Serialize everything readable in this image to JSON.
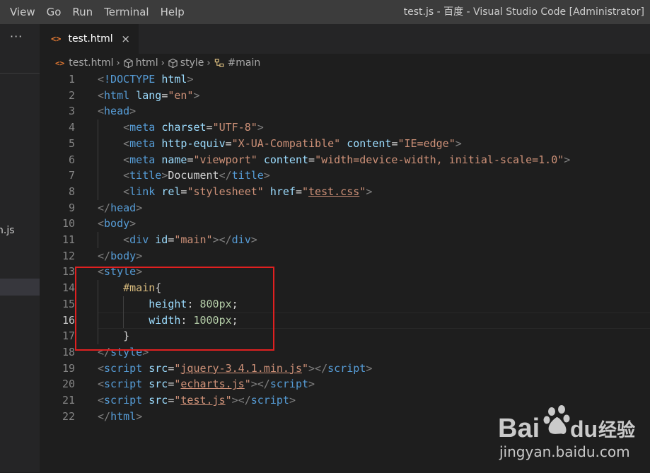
{
  "menu": [
    "View",
    "Go",
    "Run",
    "Terminal",
    "Help"
  ],
  "window_title": "test.js - 百度 - Visual Studio Code [Administrator]",
  "sidebar": {
    "more": "···",
    "file_fragment": "n.js"
  },
  "tab": {
    "icon": "<>",
    "label": "test.html",
    "close": "×"
  },
  "breadcrumb": {
    "file": "test.html",
    "html": "html",
    "style": "style",
    "main": "#main"
  },
  "editor": {
    "line_numbers": [
      "1",
      "2",
      "3",
      "4",
      "5",
      "6",
      "7",
      "8",
      "9",
      "10",
      "11",
      "12",
      "13",
      "14",
      "15",
      "16",
      "17",
      "18",
      "19",
      "20",
      "21",
      "22"
    ],
    "active_line": 16,
    "lines": [
      [
        [
          "p",
          "<"
        ],
        [
          "t",
          "!DOCTYPE"
        ],
        [
          "w",
          " "
        ],
        [
          "a",
          "html"
        ],
        [
          "p",
          ">"
        ]
      ],
      [
        [
          "p",
          "<"
        ],
        [
          "t",
          "html"
        ],
        [
          "w",
          " "
        ],
        [
          "a",
          "lang"
        ],
        [
          "w",
          "="
        ],
        [
          "s",
          "\"en\""
        ],
        [
          "p",
          ">"
        ]
      ],
      [
        [
          "p",
          "<"
        ],
        [
          "t",
          "head"
        ],
        [
          "p",
          ">"
        ]
      ],
      [
        [
          "w",
          "    "
        ],
        [
          "p",
          "<"
        ],
        [
          "t",
          "meta"
        ],
        [
          "w",
          " "
        ],
        [
          "a",
          "charset"
        ],
        [
          "w",
          "="
        ],
        [
          "s",
          "\"UTF-8\""
        ],
        [
          "p",
          ">"
        ]
      ],
      [
        [
          "w",
          "    "
        ],
        [
          "p",
          "<"
        ],
        [
          "t",
          "meta"
        ],
        [
          "w",
          " "
        ],
        [
          "a",
          "http-equiv"
        ],
        [
          "w",
          "="
        ],
        [
          "s",
          "\"X-UA-Compatible\""
        ],
        [
          "w",
          " "
        ],
        [
          "a",
          "content"
        ],
        [
          "w",
          "="
        ],
        [
          "s",
          "\"IE=edge\""
        ],
        [
          "p",
          ">"
        ]
      ],
      [
        [
          "w",
          "    "
        ],
        [
          "p",
          "<"
        ],
        [
          "t",
          "meta"
        ],
        [
          "w",
          " "
        ],
        [
          "a",
          "name"
        ],
        [
          "w",
          "="
        ],
        [
          "s",
          "\"viewport\""
        ],
        [
          "w",
          " "
        ],
        [
          "a",
          "content"
        ],
        [
          "w",
          "="
        ],
        [
          "s",
          "\"width=device-width, initial-scale=1.0\""
        ],
        [
          "p",
          ">"
        ]
      ],
      [
        [
          "w",
          "    "
        ],
        [
          "p",
          "<"
        ],
        [
          "t",
          "title"
        ],
        [
          "p",
          ">"
        ],
        [
          "w",
          "Document"
        ],
        [
          "p",
          "</"
        ],
        [
          "t",
          "title"
        ],
        [
          "p",
          ">"
        ]
      ],
      [
        [
          "w",
          "    "
        ],
        [
          "p",
          "<"
        ],
        [
          "t",
          "link"
        ],
        [
          "w",
          " "
        ],
        [
          "a",
          "rel"
        ],
        [
          "w",
          "="
        ],
        [
          "s",
          "\"stylesheet\""
        ],
        [
          "w",
          " "
        ],
        [
          "a",
          "href"
        ],
        [
          "w",
          "="
        ],
        [
          "s",
          "\""
        ],
        [
          "sl",
          "test.css"
        ],
        [
          "s",
          "\""
        ],
        [
          "p",
          ">"
        ]
      ],
      [
        [
          "p",
          "</"
        ],
        [
          "t",
          "head"
        ],
        [
          "p",
          ">"
        ]
      ],
      [
        [
          "p",
          "<"
        ],
        [
          "t",
          "body"
        ],
        [
          "p",
          ">"
        ]
      ],
      [
        [
          "w",
          "    "
        ],
        [
          "p",
          "<"
        ],
        [
          "t",
          "div"
        ],
        [
          "w",
          " "
        ],
        [
          "a",
          "id"
        ],
        [
          "w",
          "="
        ],
        [
          "s",
          "\"main\""
        ],
        [
          "p",
          "></"
        ],
        [
          "t",
          "div"
        ],
        [
          "p",
          ">"
        ]
      ],
      [
        [
          "p",
          "</"
        ],
        [
          "t",
          "body"
        ],
        [
          "p",
          ">"
        ]
      ],
      [
        [
          "p",
          "<"
        ],
        [
          "t",
          "style"
        ],
        [
          "p",
          ">"
        ]
      ],
      [
        [
          "w",
          "    "
        ],
        [
          "sel",
          "#main"
        ],
        [
          "w",
          "{"
        ]
      ],
      [
        [
          "w",
          "        "
        ],
        [
          "a",
          "height"
        ],
        [
          "w",
          ": "
        ],
        [
          "n",
          "800px"
        ],
        [
          "w",
          ";"
        ]
      ],
      [
        [
          "w",
          "        "
        ],
        [
          "a",
          "width"
        ],
        [
          "w",
          ": "
        ],
        [
          "n",
          "1000px"
        ],
        [
          "w",
          ";"
        ]
      ],
      [
        [
          "w",
          "    "
        ],
        [
          "w",
          "}"
        ]
      ],
      [
        [
          "p",
          "</"
        ],
        [
          "t",
          "style"
        ],
        [
          "p",
          ">"
        ]
      ],
      [
        [
          "p",
          "<"
        ],
        [
          "t",
          "script"
        ],
        [
          "w",
          " "
        ],
        [
          "a",
          "src"
        ],
        [
          "w",
          "="
        ],
        [
          "s",
          "\""
        ],
        [
          "sl",
          "jquery-3.4.1.min.js"
        ],
        [
          "s",
          "\""
        ],
        [
          "p",
          "></"
        ],
        [
          "t",
          "script"
        ],
        [
          "p",
          ">"
        ]
      ],
      [
        [
          "p",
          "<"
        ],
        [
          "t",
          "script"
        ],
        [
          "w",
          " "
        ],
        [
          "a",
          "src"
        ],
        [
          "w",
          "="
        ],
        [
          "s",
          "\""
        ],
        [
          "sl",
          "echarts.js"
        ],
        [
          "s",
          "\""
        ],
        [
          "p",
          "></"
        ],
        [
          "t",
          "script"
        ],
        [
          "p",
          ">"
        ]
      ],
      [
        [
          "p",
          "<"
        ],
        [
          "t",
          "script"
        ],
        [
          "w",
          " "
        ],
        [
          "a",
          "src"
        ],
        [
          "w",
          "="
        ],
        [
          "s",
          "\""
        ],
        [
          "sl",
          "test.js"
        ],
        [
          "s",
          "\""
        ],
        [
          "p",
          "></"
        ],
        [
          "t",
          "script"
        ],
        [
          "p",
          ">"
        ]
      ],
      [
        [
          "p",
          "</"
        ],
        [
          "t",
          "html"
        ],
        [
          "p",
          ">"
        ]
      ]
    ]
  },
  "watermark": {
    "brand_left": "Bai",
    "brand_right": "du",
    "brand_cn": "经验",
    "url": "jingyan.baidu.com"
  },
  "colors": {
    "tag": "#569cd6",
    "attribute": "#9cdcfe",
    "string": "#ce9178",
    "selector": "#d7ba7d",
    "number": "#b5cea8",
    "highlight_box": "#e02020",
    "html_icon": "#e37933"
  }
}
